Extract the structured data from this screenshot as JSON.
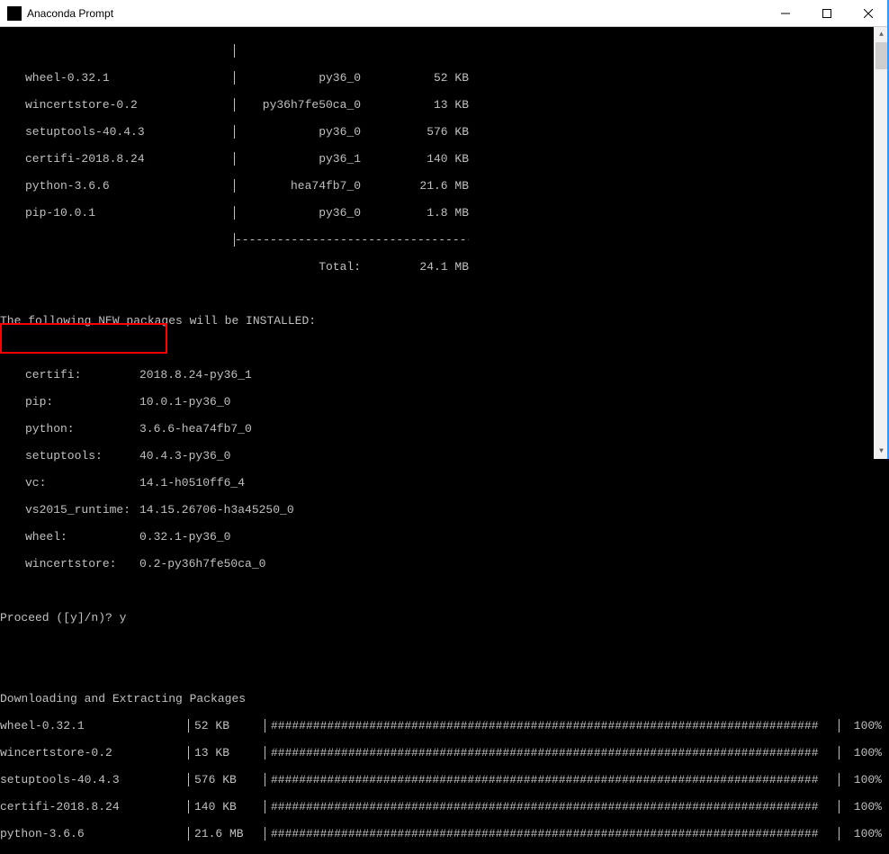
{
  "window": {
    "title": "Anaconda Prompt"
  },
  "packages_top": [
    {
      "name": "wheel-0.32.1",
      "build": "py36_0",
      "size": "52 KB"
    },
    {
      "name": "wincertstore-0.2",
      "build": "py36h7fe50ca_0",
      "size": "13 KB"
    },
    {
      "name": "setuptools-40.4.3",
      "build": "py36_0",
      "size": "576 KB"
    },
    {
      "name": "certifi-2018.8.24",
      "build": "py36_1",
      "size": "140 KB"
    },
    {
      "name": "python-3.6.6",
      "build": "hea74fb7_0",
      "size": "21.6 MB"
    },
    {
      "name": "pip-10.0.1",
      "build": "py36_0",
      "size": "1.8 MB"
    }
  ],
  "total_label": "Total:",
  "total_size": "24.1 MB",
  "new_packages_header": "The following NEW packages will be INSTALLED:",
  "new_packages": [
    {
      "name": "certifi:",
      "ver": "2018.8.24-py36_1"
    },
    {
      "name": "pip:",
      "ver": "10.0.1-py36_0"
    },
    {
      "name": "python:",
      "ver": "3.6.6-hea74fb7_0"
    },
    {
      "name": "setuptools:",
      "ver": "40.4.3-py36_0"
    },
    {
      "name": "vc:",
      "ver": "14.1-h0510ff6_4"
    },
    {
      "name": "vs2015_runtime:",
      "ver": "14.15.26706-h3a45250_0"
    },
    {
      "name": "wheel:",
      "ver": "0.32.1-py36_0"
    },
    {
      "name": "wincertstore:",
      "ver": "0.2-py36h7fe50ca_0"
    }
  ],
  "prompt_line": "Proceed ([y]/n)? y",
  "downloading_header": "Downloading and Extracting Packages",
  "downloads": [
    {
      "name": "wheel-0.32.1",
      "size": "52 KB",
      "pct": "100%"
    },
    {
      "name": "wincertstore-0.2",
      "size": "13 KB",
      "pct": "100%"
    },
    {
      "name": "setuptools-40.4.3",
      "size": "576 KB",
      "pct": "100%"
    },
    {
      "name": "certifi-2018.8.24",
      "size": "140 KB",
      "pct": "100%"
    },
    {
      "name": "python-3.6.6",
      "size": "21.6 MB",
      "pct": "100%"
    }
  ],
  "progress_bar": "##############################################################################",
  "dashes": "------------------------------------------------------------"
}
